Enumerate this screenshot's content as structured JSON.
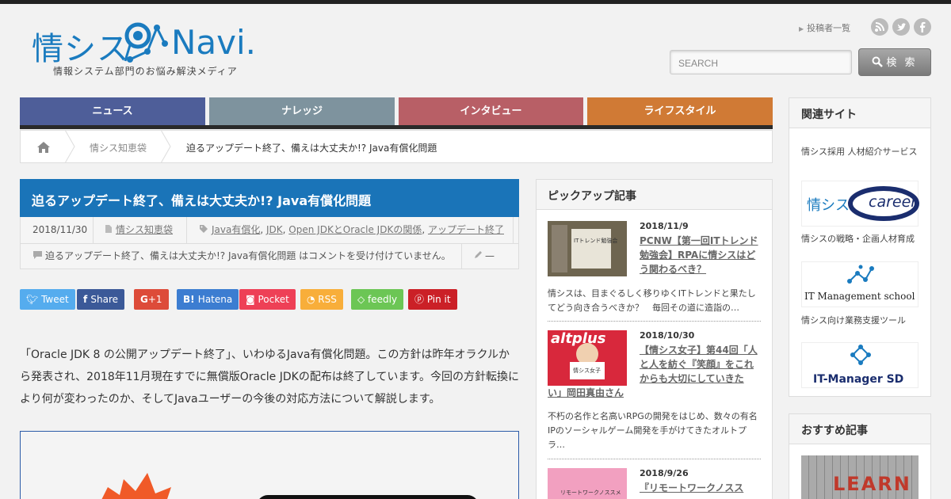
{
  "header": {
    "logo_text": "情シス",
    "logo_navi": "Navi.",
    "logo_sub": "情報システム部門のお悩み解決メディア",
    "contributors_link": "投稿者一覧",
    "social_icons": [
      "rss-icon",
      "twitter-icon",
      "facebook-icon"
    ],
    "search_placeholder": "SEARCH",
    "search_button": "検 索"
  },
  "nav": {
    "items": [
      {
        "label": "ニュース",
        "color": "#4e5e99"
      },
      {
        "label": "ナレッジ",
        "color": "#7e939e"
      },
      {
        "label": "インタビュー",
        "color": "#b85f66"
      },
      {
        "label": "ライフスタイル",
        "color": "#d07a35"
      }
    ]
  },
  "breadcrumb": {
    "items": [
      "情シス知恵袋",
      "迫るアップデート終了、備えは大丈夫か!? Java有償化問題"
    ]
  },
  "article": {
    "title": "迫るアップデート終了、備えは大丈夫か!? Java有償化問題",
    "date": "2018/11/30",
    "category": "情シス知恵袋",
    "tags": [
      "Java有償化",
      "JDK",
      "Open JDKとOracle JDKの関係",
      "アップデート終了"
    ],
    "comment_note": "迫るアップデート終了、備えは大丈夫か!? Java有償化問題 はコメントを受け付けていません。",
    "edit_mark": "—",
    "body": "「Oracle JDK 8 の公開アップデート終了」、いわゆるJava有償化問題。この方針は昨年オラクルから発表され、2018年11月現在すでに無償版Oracle JDKの配布は終了しています。今回の方針転換により何が変わったのか、そしてJavaユーザーの今後の対応方法について解説します。"
  },
  "share": [
    {
      "label": "Tweet",
      "color": "#55acee",
      "icon": "twitter-icon"
    },
    {
      "label": "Share",
      "color": "#3b5998",
      "icon": "facebook-icon"
    },
    {
      "label": "+1",
      "color": "#dd4b39",
      "icon": "google-plus-icon"
    },
    {
      "label": "Hatena",
      "color": "#3c7dd1",
      "icon": "hatena-icon"
    },
    {
      "label": "Pocket",
      "color": "#ee4056",
      "icon": "pocket-icon"
    },
    {
      "label": "RSS",
      "color": "#f8ae3a",
      "icon": "rss-icon"
    },
    {
      "label": "feedly",
      "color": "#6cc655",
      "icon": "feedly-icon"
    },
    {
      "label": "Pin it",
      "color": "#cb2027",
      "icon": "pinterest-icon"
    }
  ],
  "pickup": {
    "heading": "ピックアップ記事",
    "items": [
      {
        "date": "2018/11/9",
        "title": "PCNW【第一回ITトレンド勉強会】RPAに情シスはどう関わるべき？",
        "desc": "情シスは、目まぐるしく移りゆくITトレンドと果たしてどう向き合うべきか？　毎回その道に造詣の…"
      },
      {
        "date": "2018/10/30",
        "title_a": "【情シス女子】第44回「人と人を紡ぐ『笑顔』をこれからも大切にしていきた",
        "title_b": "い」岡田真由さん",
        "desc": "不朽の名作と名高いRPGの開発をはじめ、数々の有名IPのソーシャルゲーム開発を手がけてきたオルトプラ…"
      },
      {
        "date": "2018/9/26",
        "title": "『リモートワークノスス"
      }
    ],
    "thumb_texts": [
      "ITトレンド勉強会",
      "altplus",
      "情シス女子",
      "リモートワークノススメ"
    ]
  },
  "sidebar": {
    "related_heading": "関連サイト",
    "related": [
      {
        "label": "情シス採用 人材紹介サービス",
        "banner_a": "情シス",
        "banner_b": "career"
      },
      {
        "label": "情シスの戦略・企画人材育成",
        "banner": "IT Management school"
      },
      {
        "label": "情シス向け業務支援ツール",
        "banner": "IT-Manager SD"
      }
    ],
    "recommended_heading": "おすすめ記事",
    "recommended_thumb_text": "LEARN"
  }
}
